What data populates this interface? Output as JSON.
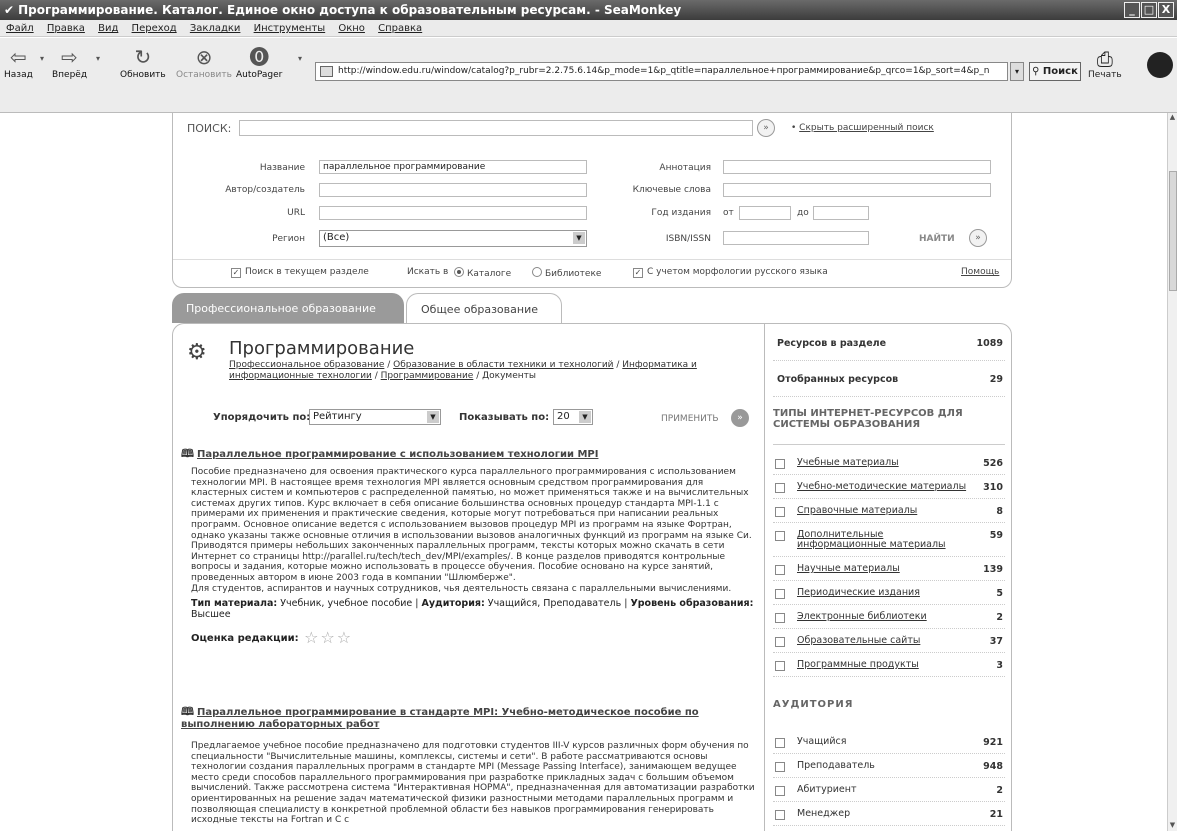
{
  "window": {
    "title": "Программирование. Каталог. Единое окно доступа к образовательным ресурсам. - SeaMonkey",
    "btn_min": "_",
    "btn_max": "□",
    "btn_close": "X"
  },
  "menu": [
    "Файл",
    "Правка",
    "Вид",
    "Переход",
    "Закладки",
    "Инструменты",
    "Окно",
    "Справка"
  ],
  "nav": {
    "back": "Назад",
    "forward": "Вперёд",
    "reload": "Обновить",
    "stop": "Остановить",
    "autopager": "AutoPager",
    "url": "http://window.edu.ru/window/catalog?p_rubr=2.2.75.6.14&p_mode=1&p_qtitle=параллельное+программирование&p_qrco=1&p_sort=4&p_n",
    "search": "Поиск",
    "print": "Печать"
  },
  "search": {
    "label": "ПОИСК:",
    "hide_link": "Скрыть расширенный поиск",
    "name_label": "Название",
    "name_value": "параллельное программирование",
    "author_label": "Автор/создатель",
    "url_label": "URL",
    "region_label": "Регион",
    "region_value": "(Все)",
    "annot_label": "Аннотация",
    "keywords_label": "Ключевые слова",
    "year_label": "Год издания",
    "year_from": "от",
    "year_to": "до",
    "isbn_label": "ISBN/ISSN",
    "find": "НАЙТИ",
    "opt_section": "Поиск в текущем разделе",
    "search_in": "Искать в",
    "opt_catalog": "Каталоге",
    "opt_library": "Библиотеке",
    "opt_morph": "С учетом морфологии русского языка",
    "help": "Помощь"
  },
  "tabs": {
    "prof": "Профессиональное образование",
    "general": "Общее образование"
  },
  "category": {
    "title": "Программирование",
    "crumb1": "Профессиональное образование",
    "crumb2": "Образование в области техники и технологий",
    "crumb3": "Информатика и информационные технологии",
    "crumb4": "Программирование",
    "crumb5": "Документы",
    "sep": " / "
  },
  "sort": {
    "order_label": "Упорядочить по:",
    "order_value": "Рейтингу",
    "show_label": "Показывать по:",
    "show_value": "20",
    "apply": "ПРИМЕНИТЬ"
  },
  "results": [
    {
      "title": "Параллельное программирование с использованием технологии MPI",
      "desc": "Пособие предназначено для освоения практического курса параллельного программирования с использованием технологии MPI. В настоящее время технология MPI является основным средством программирования для кластерных систем и компьютеров с распределенной памятью, но может применяться также и на вычислительных системах других типов. Курс включает в себя описание большинства основных процедур стандарта MPI-1.1 с примерами их применения и практические сведения, которые могут потребоваться при написании реальных программ. Основное описание ведется с использованием вызовов процедур MPI из программ на языке Фортран, однако указаны также основные отличия в использовании вызовов аналогичных функций из программ на языке Си. Приводятся примеры небольших законченных параллельных программ, тексты которых можно скачать в сети Интернет со страницы http://parallel.ru/tech/tech_dev/MPI/examples/. В конце разделов приводятся контрольные вопросы и задания, которые можно использовать в процессе обучения. Пособие основано на курсе занятий, проведенных автором в июне 2003 года в компании \"Шлюмберже\".",
      "desc2": "Для студентов, аспирантов и научных сотрудников, чья деятельность связана с параллельными вычислениями.",
      "type_label": "Тип материала:",
      "type_value": "Учебник, учебное пособие",
      "aud_label": "Аудитория:",
      "aud_value": "Учащийся, Преподаватель",
      "level_label": "Уровень образования:",
      "level_value": "Высшее",
      "sep": " | ",
      "rating_label": "Оценка редакции:",
      "stars": 3
    },
    {
      "title": "Параллельное программирование в стандарте MPI: Учебно-методическое пособие по выполнению лабораторных работ",
      "desc": "Предлагаемое учебное пособие предназначено для подготовки студентов III-V курсов различных форм обучения по специальности \"Вычислительные машины, комплексы, системы и сети\". В работе рассматриваются основы технологии создания параллельных программ в стандарте MPI (Message Passing Interface), занимающем ведущее место среди способов параллельного программирования при разработке прикладных задач с большим объемом вычислений. Также рассмотрена система \"Интерактивная НОРМА\", предназначенная для автоматизации разработки ориентированных на решение задач математической физики разностными методами параллельных программ и позволяющая специалисту в конкретной проблемной области без навыков программирования генерировать исходные тексты на Fortran и C с"
    }
  ],
  "sidebar": {
    "res_in_section_label": "Ресурсов в разделе",
    "res_in_section": "1089",
    "selected_label": "Отобранных ресурсов",
    "selected": "29",
    "types_head": "ТИПЫ ИНТЕРНЕТ-РЕСУРСОВ ДЛЯ СИСТЕМЫ ОБРАЗОВАНИЯ",
    "types": [
      {
        "label": "Учебные материалы",
        "count": "526"
      },
      {
        "label": "Учебно-методические материалы",
        "count": "310"
      },
      {
        "label": "Справочные материалы",
        "count": "8"
      },
      {
        "label": "Дополнительные информационные материалы",
        "count": "59"
      },
      {
        "label": "Научные материалы",
        "count": "139"
      },
      {
        "label": "Периодические издания",
        "count": "5"
      },
      {
        "label": "Электронные библиотеки",
        "count": "2"
      },
      {
        "label": "Образовательные сайты",
        "count": "37"
      },
      {
        "label": "Программные продукты",
        "count": "3"
      }
    ],
    "audience_head": "АУДИТОРИЯ",
    "audience": [
      {
        "label": "Учащийся",
        "count": "921"
      },
      {
        "label": "Преподаватель",
        "count": "948"
      },
      {
        "label": "Абитуриент",
        "count": "2"
      },
      {
        "label": "Менеджер",
        "count": "21"
      }
    ]
  }
}
